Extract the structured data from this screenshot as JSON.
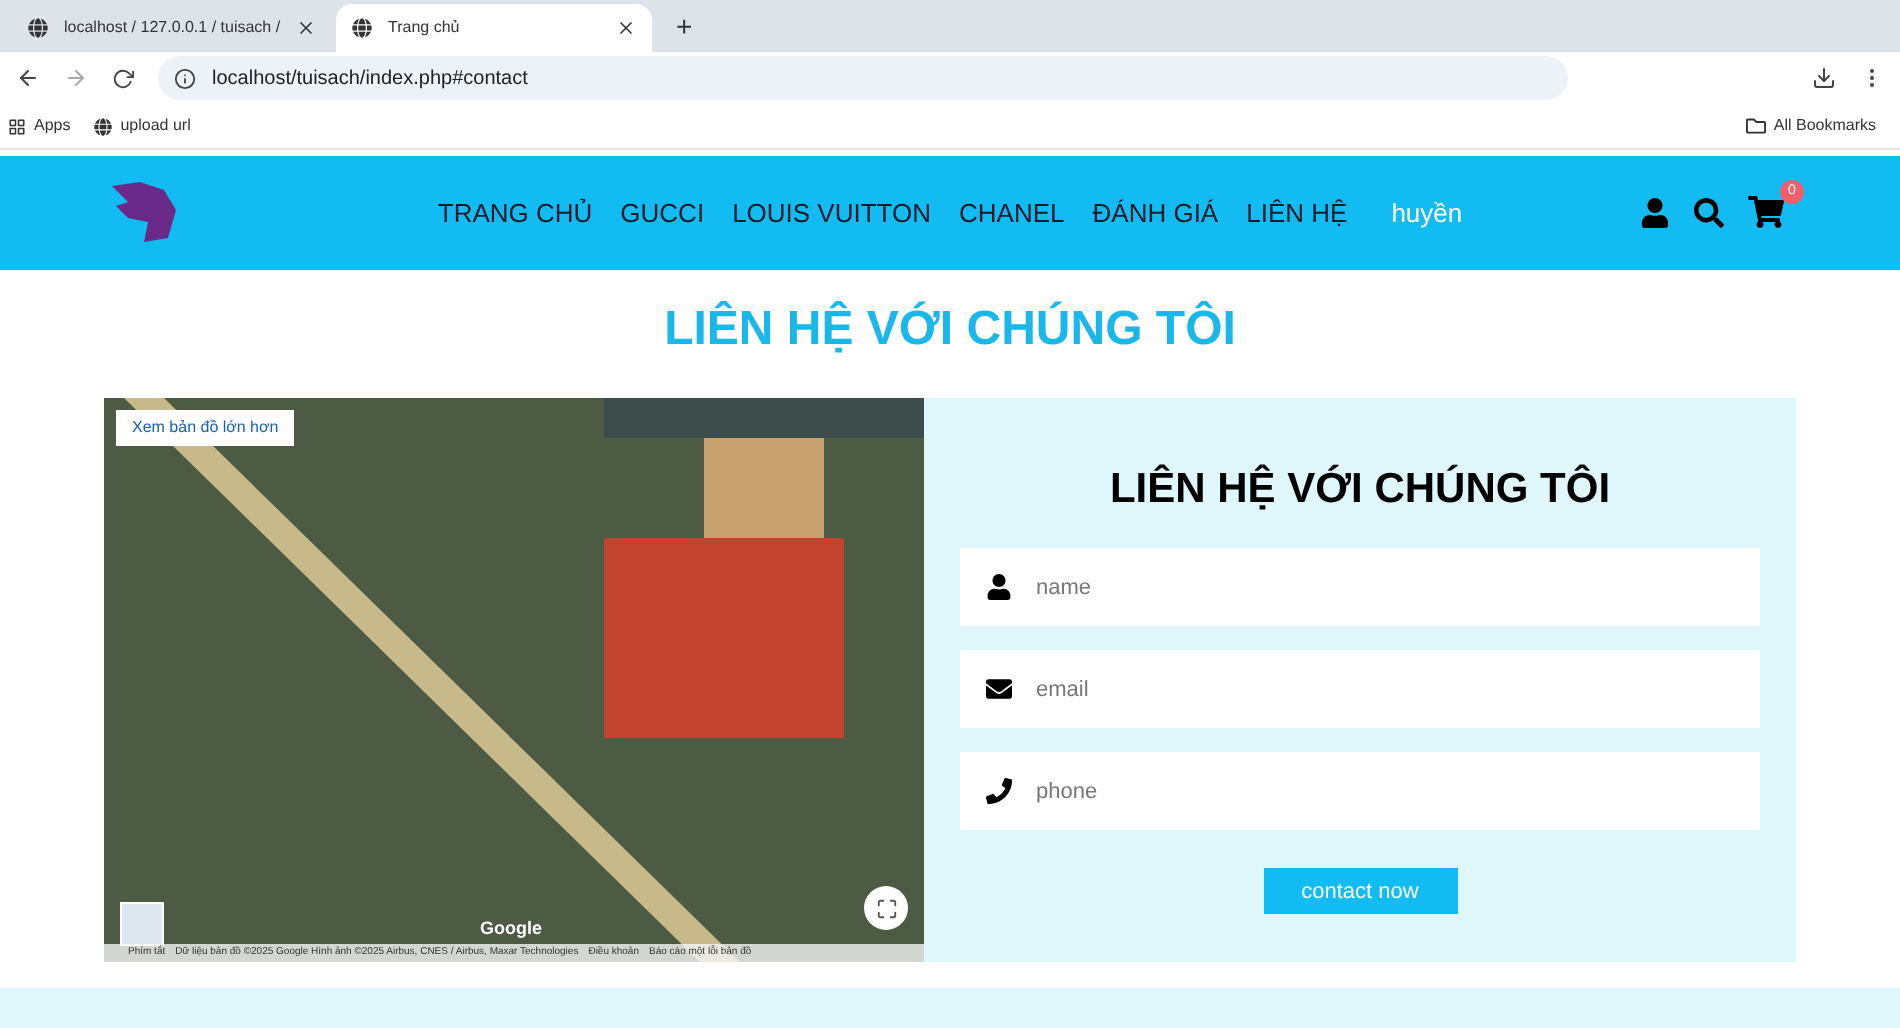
{
  "browser": {
    "tabs": [
      {
        "title": "localhost / 127.0.0.1 / tuisach /",
        "selected": false
      },
      {
        "title": "Trang chủ",
        "selected": true
      }
    ],
    "new_tab": "+",
    "address": "localhost/tuisach/index.php#contact",
    "bookmarks": [
      {
        "label": "Apps",
        "kind": "apps"
      },
      {
        "label": "upload url",
        "kind": "site"
      }
    ],
    "all_bookmarks": "All Bookmarks"
  },
  "nav": {
    "items": [
      {
        "label": "TRANG CHỦ"
      },
      {
        "label": "GUCCI"
      },
      {
        "label": "LOUIS VUITTON"
      },
      {
        "label": "CHANEL"
      },
      {
        "label": "ĐÁNH GIÁ"
      },
      {
        "label": "LIÊN HỆ"
      }
    ],
    "user": "huyền",
    "cart_count": "0"
  },
  "page_title": "LIÊN HỆ VỚI CHÚNG TÔI",
  "map": {
    "larger_map_link": "Xem bản đồ lớn hơn",
    "logo": "Google",
    "footer": [
      "Phím tắt",
      "Dữ liệu bản đồ ©2025 Google Hình ảnh ©2025 Airbus, CNES / Airbus, Maxar Technologies",
      "Điều khoản",
      "Báo cáo một lỗi bản đồ"
    ]
  },
  "form": {
    "title": "LIÊN HỆ VỚI CHÚNG TÔI",
    "fields": [
      {
        "kind": "person",
        "placeholder": "name"
      },
      {
        "kind": "mail",
        "placeholder": "email"
      },
      {
        "kind": "phone",
        "placeholder": "phone"
      }
    ],
    "submit": "contact now"
  }
}
